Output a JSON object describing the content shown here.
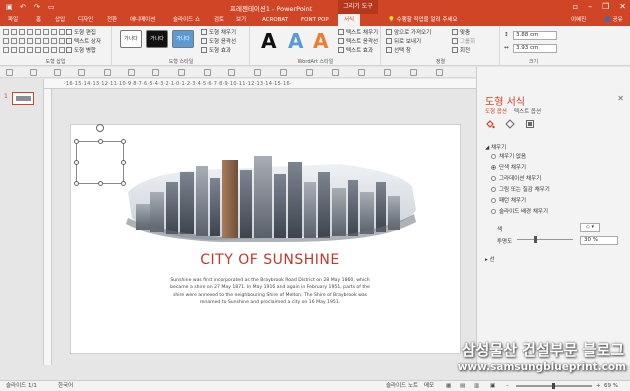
{
  "app": {
    "window_title": "프레젠테이션1 - PowerPoint",
    "contextual_tab": "그리기 도구",
    "accent": "#d04526"
  },
  "tabs": [
    {
      "label": "파일"
    },
    {
      "label": "홈"
    },
    {
      "label": "삽입"
    },
    {
      "label": "디자인"
    },
    {
      "label": "전환"
    },
    {
      "label": "애니메이션"
    },
    {
      "label": "슬라이드 쇼"
    },
    {
      "label": "검토"
    },
    {
      "label": "보기"
    },
    {
      "label": "ACROBAT"
    },
    {
      "label": "FONT POP"
    },
    {
      "label": "서식"
    }
  ],
  "tell_me": "수행할 작업을 알려 주세요",
  "user": {
    "name": "이혜진",
    "share": "공유"
  },
  "ribbon": {
    "groups": {
      "insert_shapes": "도형 삽입",
      "shape_styles": "도형 스타일",
      "wordart_styles": "WordArt 스타일",
      "arrange": "정렬",
      "size": "크기"
    },
    "shape_edit": "도형 편집",
    "text_box": "텍스트 상자",
    "merge_shapes": "도형 병합",
    "style_sample": "가나다",
    "shape_fill": "도형 채우기",
    "shape_outline": "도형 윤곽선",
    "shape_effects": "도형 효과",
    "wordart_letter": "A",
    "text_fill": "텍스트 채우기",
    "text_outline": "텍스트 윤곽선",
    "text_effects": "텍스트 효과",
    "bring_forward": "앞으로 가져오기",
    "send_backward": "뒤로 보내기",
    "selection_pane": "선택 창",
    "align": "맞춤",
    "group": "그룹화",
    "rotate": "회전",
    "height": "3.88 cm",
    "width": "3.93 cm"
  },
  "ruler_text": "·16·15·14·13·12·11·10·9·8·7·6·5·4·3·2·1·0·1·2·3·4·5·6·7·8·9·10·11·12·13·14·15·16·",
  "thumbnails": [
    {
      "number": "1"
    }
  ],
  "slide": {
    "title": "CITY OF SUNSHINE",
    "body": "Sunshine was first incorporated as the Braybrook Road District on 28 May 1860, which became a shire on 27 May 1871. In May 1916 and again in February 1951, parts of the shire were annexed to the neighbouring Shire of Melton. The Shire of Braybrook was renamed to Sunshine and proclaimed a city on 16 May 1951."
  },
  "format_pane": {
    "title": "도형 서식",
    "tabs": [
      "도형 옵션",
      "텍스트 옵션"
    ],
    "section": "채우기",
    "fill_options": [
      {
        "label": "채우기 없음",
        "selected": false
      },
      {
        "label": "단색 채우기",
        "selected": true
      },
      {
        "label": "그라데이션 채우기",
        "selected": false
      },
      {
        "label": "그림 또는 질감 채우기",
        "selected": false
      },
      {
        "label": "패턴 채우기",
        "selected": false
      },
      {
        "label": "슬라이드 배경 채우기",
        "selected": false
      }
    ],
    "color_label": "색",
    "transparency_label": "투명도",
    "transparency_value": "30 %",
    "transparency": 0.3,
    "line_section": "선"
  },
  "status": {
    "slide_info": "슬라이드 1/1",
    "language": "한국어",
    "notes": "슬라이드 노트",
    "comments": "메모",
    "zoom": "69 %"
  },
  "watermark": {
    "line1": "삼성물산 건설부문 블로그",
    "line2": "www.samsungblueprint.com"
  }
}
